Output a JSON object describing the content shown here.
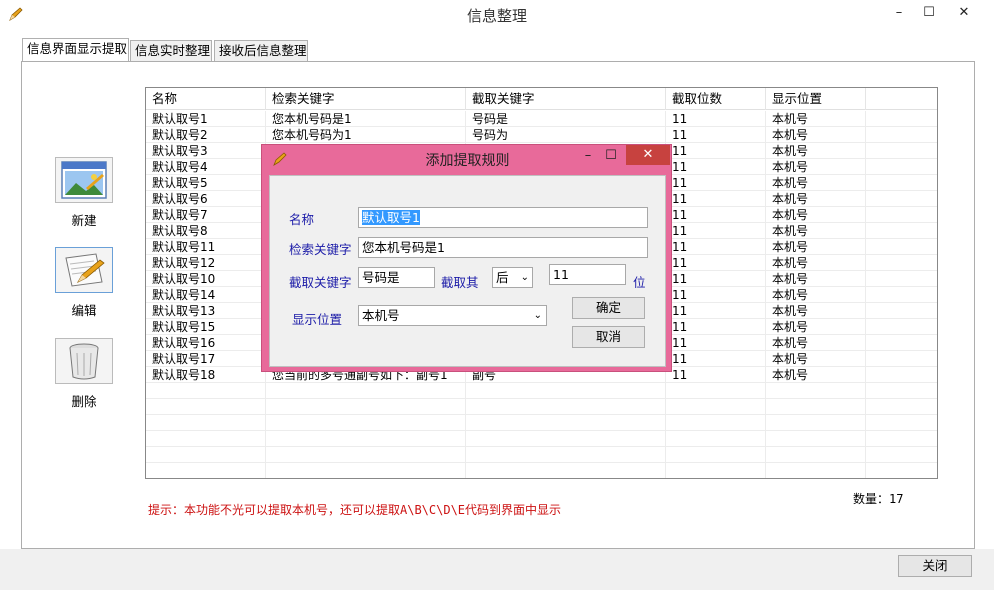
{
  "window": {
    "title": "信息整理",
    "minimize": "–",
    "maximize": "☐",
    "close": "✕"
  },
  "tabs": [
    {
      "label": "信息界面显示提取",
      "active": true
    },
    {
      "label": "信息实时整理",
      "active": false
    },
    {
      "label": "接收后信息整理",
      "active": false
    }
  ],
  "sidebar": {
    "new_label": "新建",
    "edit_label": "编辑",
    "delete_label": "删除"
  },
  "table": {
    "headers": [
      "名称",
      "检索关键字",
      "截取关键字",
      "截取位数",
      "显示位置"
    ],
    "rows": [
      [
        "默认取号1",
        "您本机号码是1",
        "号码是",
        "11",
        "本机号"
      ],
      [
        "默认取号2",
        "您本机号码为1",
        "号码为",
        "11",
        "本机号"
      ],
      [
        "默认取号3",
        "",
        "",
        "11",
        "本机号"
      ],
      [
        "默认取号4",
        "",
        "",
        "11",
        "本机号"
      ],
      [
        "默认取号5",
        "",
        "",
        "11",
        "本机号"
      ],
      [
        "默认取号6",
        "",
        "",
        "11",
        "本机号"
      ],
      [
        "默认取号7",
        "",
        "",
        "11",
        "本机号"
      ],
      [
        "默认取号8",
        "",
        "",
        "11",
        "本机号"
      ],
      [
        "默认取号11",
        "",
        "",
        "11",
        "本机号"
      ],
      [
        "默认取号12",
        "",
        "",
        "11",
        "本机号"
      ],
      [
        "默认取号10",
        "",
        "",
        "11",
        "本机号"
      ],
      [
        "默认取号14",
        "",
        "",
        "11",
        "本机号"
      ],
      [
        "默认取号13",
        "",
        "",
        "11",
        "本机号"
      ],
      [
        "默认取号15",
        "",
        "",
        "11",
        "本机号"
      ],
      [
        "默认取号16",
        "",
        "",
        "11",
        "本机号"
      ],
      [
        "默认取号17",
        "",
        "",
        "11",
        "本机号"
      ],
      [
        "默认取号18",
        "您当前的多号通副号如下：副号1",
        "副号",
        "11",
        "本机号"
      ]
    ]
  },
  "hint": "提示：本功能不光可以提取本机号，还可以提取A\\B\\C\\D\\E代码到界面中显示",
  "count": "数量：17",
  "close_button": "关闭",
  "dialog": {
    "title": "添加提取规则",
    "minimize": "–",
    "maximize": "☐",
    "close": "✕",
    "name_label": "名称",
    "name_value": "默认取号1",
    "search_label": "检索关键字",
    "search_value": "您本机号码是1",
    "cut_label": "截取关键字",
    "cut_value": "号码是",
    "cut_which_label": "截取其",
    "cut_direction": "后",
    "cut_digits": "11",
    "digits_unit": "位",
    "display_label": "显示位置",
    "display_value": "本机号",
    "ok_button": "确定",
    "cancel_button": "取消"
  }
}
